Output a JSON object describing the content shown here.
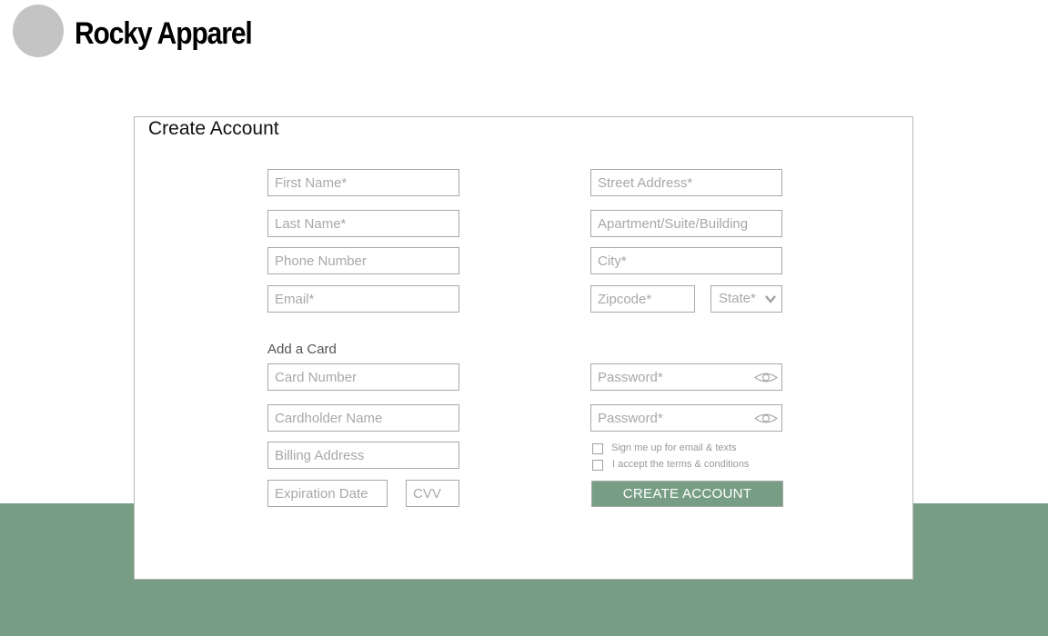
{
  "header": {
    "brand": "Rocky Apparel"
  },
  "form": {
    "title": "Create Account",
    "first_name": {
      "value": "",
      "placeholder": "First Name*"
    },
    "last_name": {
      "value": "",
      "placeholder": "Last Name*"
    },
    "phone": {
      "value": "",
      "placeholder": "Phone Number"
    },
    "email": {
      "value": "",
      "placeholder": "Email*"
    },
    "street": {
      "value": "",
      "placeholder": "Street Address*"
    },
    "apartment": {
      "value": "",
      "placeholder": "Apartment/Suite/Building"
    },
    "city": {
      "value": "",
      "placeholder": "City*"
    },
    "zipcode": {
      "value": "",
      "placeholder": "Zipcode*"
    },
    "state": {
      "selected": "State*",
      "icon": "chevron-down-icon"
    },
    "card_section_label": "Add a Card",
    "card_number": {
      "value": "",
      "placeholder": "Card Number"
    },
    "cardholder": {
      "value": "",
      "placeholder": "Cardholder Name"
    },
    "billing": {
      "value": "",
      "placeholder": "Billing Address"
    },
    "expiration": {
      "value": "",
      "placeholder": "Expiration Date"
    },
    "cvv": {
      "value": "",
      "placeholder": "CVV"
    },
    "password": {
      "value": "",
      "placeholder": "Password*",
      "icon": "eye-icon"
    },
    "password_confirm": {
      "value": "",
      "placeholder": "Password*",
      "icon": "eye-icon"
    },
    "signup_checkbox": {
      "label": "Sign me up for email & texts",
      "checked": false
    },
    "terms_checkbox": {
      "label": "I accept the terms & conditions",
      "checked": false
    },
    "submit_label": "CREATE ACCOUNT"
  },
  "colors": {
    "accent": "#779e84",
    "logo": "#c4c4c4",
    "border": "#a8a8a8",
    "placeholder": "#a8a8a8"
  }
}
